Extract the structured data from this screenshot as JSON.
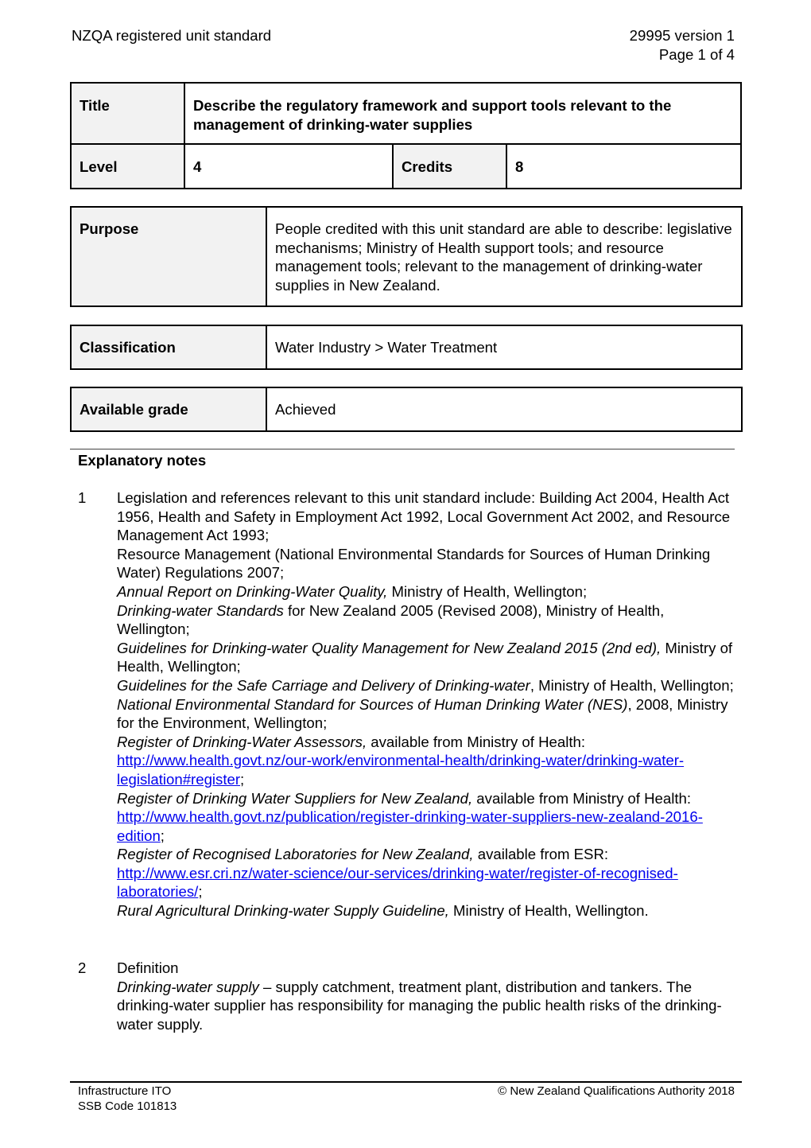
{
  "header": {
    "left": "NZQA registered unit standard",
    "right_line1": "29995 version 1",
    "right_line2": "Page 1 of 4"
  },
  "summary": {
    "title_label": "Title",
    "title_value": "Describe the regulatory framework and support tools relevant to the management of drinking-water supplies",
    "level_label": "Level",
    "level_value": "4",
    "credits_label": "Credits",
    "credits_value": "8",
    "purpose_label": "Purpose",
    "purpose_value": "People credited with this unit standard are able to describe: legislative mechanisms; Ministry of Health support tools; and resource management tools; relevant to the management of drinking-water supplies in New Zealand.",
    "classification_label": "Classification",
    "classification_value": "Water Industry > Water Treatment",
    "grade_label": "Available grade",
    "grade_value": "Achieved"
  },
  "notes": {
    "heading": "Explanatory notes",
    "note1": {
      "number": "1",
      "intro": "Legislation and references relevant to this unit standard include: Building Act 2004, Health Act 1956, Health and Safety in Employment Act 1992, Local Government Act 2002, and Resource Management Act 1993;",
      "rm_regs": "Resource Management (National Environmental Standards for Sources of Human Drinking Water) Regulations 2007;",
      "ref1_title": "Annual Report on Drinking-Water Quality,",
      "ref1_rest": " Ministry of Health, Wellington;",
      "ref2_title": "Drinking-water Standards",
      "ref2_rest": " for New Zealand 2005 (Revised 2008), Ministry of Health, Wellington;",
      "ref3_title": "Guidelines for Drinking-water Quality Management for New Zealand 2015 (2nd ed),",
      "ref3_rest": " Ministry of Health, Wellington;",
      "ref4_title": "Guidelines for the Safe Carriage and Delivery of Drinking-water",
      "ref4_rest": ", Ministry of Health, Wellington;",
      "ref5_title": "National Environmental Standard for Sources of Human Drinking Water (NES)",
      "ref5_rest": ", 2008, Ministry for the Environment, Wellington;",
      "ref6_title": "Register of Drinking-Water Assessors,",
      "ref6_rest": " available from Ministry of Health: ",
      "ref6_link": "http://www.health.govt.nz/our-work/environmental-health/drinking-water/drinking-water-legislation#register",
      "ref6_end": ";",
      "ref7_title": "Register of Drinking Water Suppliers for New Zealand,",
      "ref7_rest": " available from Ministry of Health: ",
      "ref7_link": "http://www.health.govt.nz/publication/register-drinking-water-suppliers-new-zealand-2016-edition",
      "ref7_end": ";",
      "ref8_title": "Register of Recognised Laboratories for New Zealand,",
      "ref8_rest": " available from ESR: ",
      "ref8_link": "http://www.esr.cri.nz/water-science/our-services/drinking-water/register-of-recognised-laboratories/",
      "ref8_end": ";",
      "ref9_title": "Rural Agricultural Drinking-water Supply Guideline,",
      "ref9_rest": " Ministry of Health, Wellington."
    },
    "note2": {
      "number": "2",
      "heading": "Definition",
      "term": "Drinking-water supply",
      "definition": " – supply catchment, treatment plant, distribution and tankers. The drinking-water supplier has responsibility for managing the public health risks of the drinking-water supply."
    }
  },
  "footer": {
    "org": "Infrastructure ITO",
    "ssb_code": "SSB Code 101813",
    "copyright": "© New Zealand Qualifications Authority 2018"
  }
}
